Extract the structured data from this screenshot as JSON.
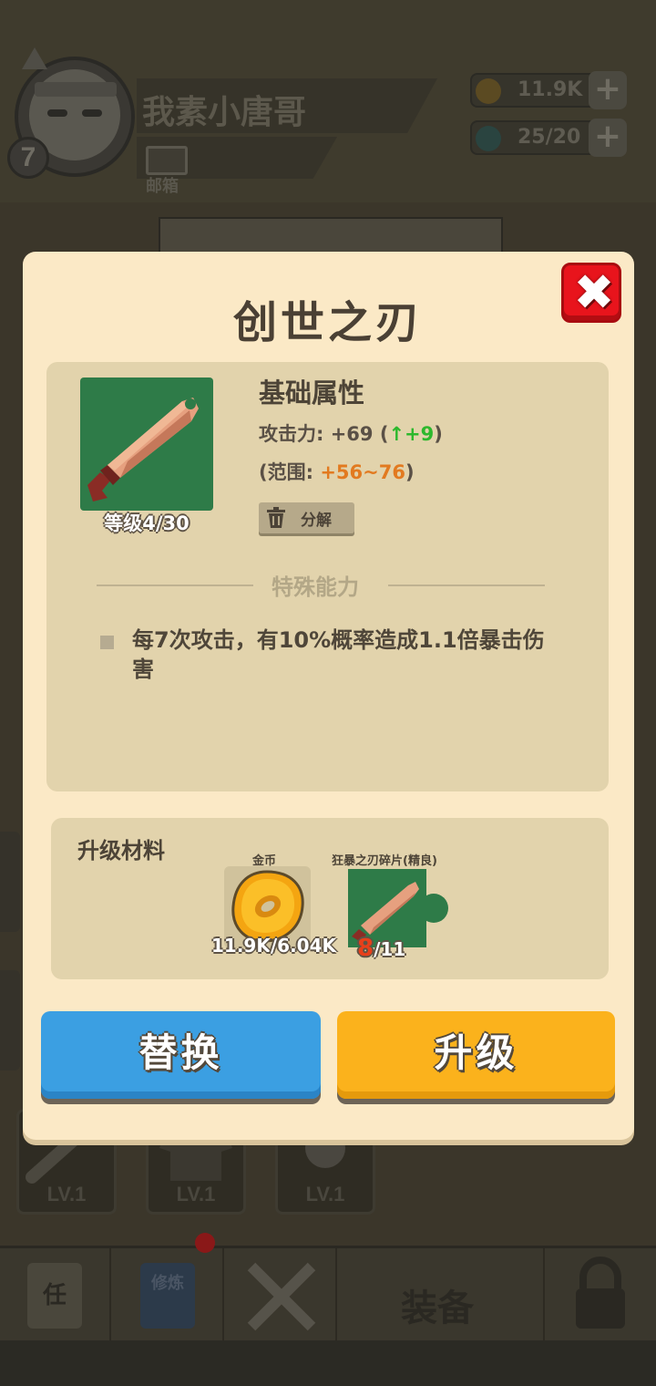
{
  "header": {
    "player_name": "我素小唐哥",
    "player_level": "7",
    "mail_label": "邮箱",
    "gold_value": "11.9K",
    "gem_value": "25/20"
  },
  "equipment_slots": [
    {
      "label": "LV.1",
      "icon": "sword-icon"
    },
    {
      "label": "LV.1",
      "icon": "armor-icon"
    },
    {
      "label": "LV.1",
      "icon": "orb-icon"
    }
  ],
  "bottom_nav": {
    "task_glyph": "任",
    "train_glyph": "修炼",
    "equip_label": "装备"
  },
  "item_dialog": {
    "title": "创世之刃",
    "close_icon": "close-icon",
    "item_icon": "blade-icon",
    "level_text": "等级4/30",
    "base_attr_title": "基础属性",
    "attack_label": "攻击力: +69 (",
    "attack_up_arrow": "↑",
    "attack_up_value": "+9",
    "attack_close": ")",
    "range_open": "(范围: ",
    "range_value": "+56~76",
    "range_close": ")",
    "decompose_label": "分解",
    "special_title": "特殊能力",
    "special_text": "每7次攻击，有10%概率造成1.1倍暴击伤害",
    "materials_title": "升级材料",
    "materials": [
      {
        "label": "金币",
        "owned": "11.9K",
        "required": "/6.04K",
        "icon": "gold-coin-icon"
      },
      {
        "label": "狂暴之刃碎片(精良)",
        "owned": "8",
        "required": "/11",
        "icon": "blade-shard-icon"
      }
    ],
    "replace_button": "替换",
    "upgrade_button": "升级"
  },
  "colors": {
    "dialog_bg": "#fbe9c6",
    "panel_bg": "#e2d3ac",
    "close_red": "#e8141c",
    "replace_blue": "#3b9fe2",
    "upgrade_yellow": "#fbb21c",
    "increase_green": "#2db82d",
    "range_orange": "#e27a20",
    "shortage_red": "#e8401a"
  }
}
